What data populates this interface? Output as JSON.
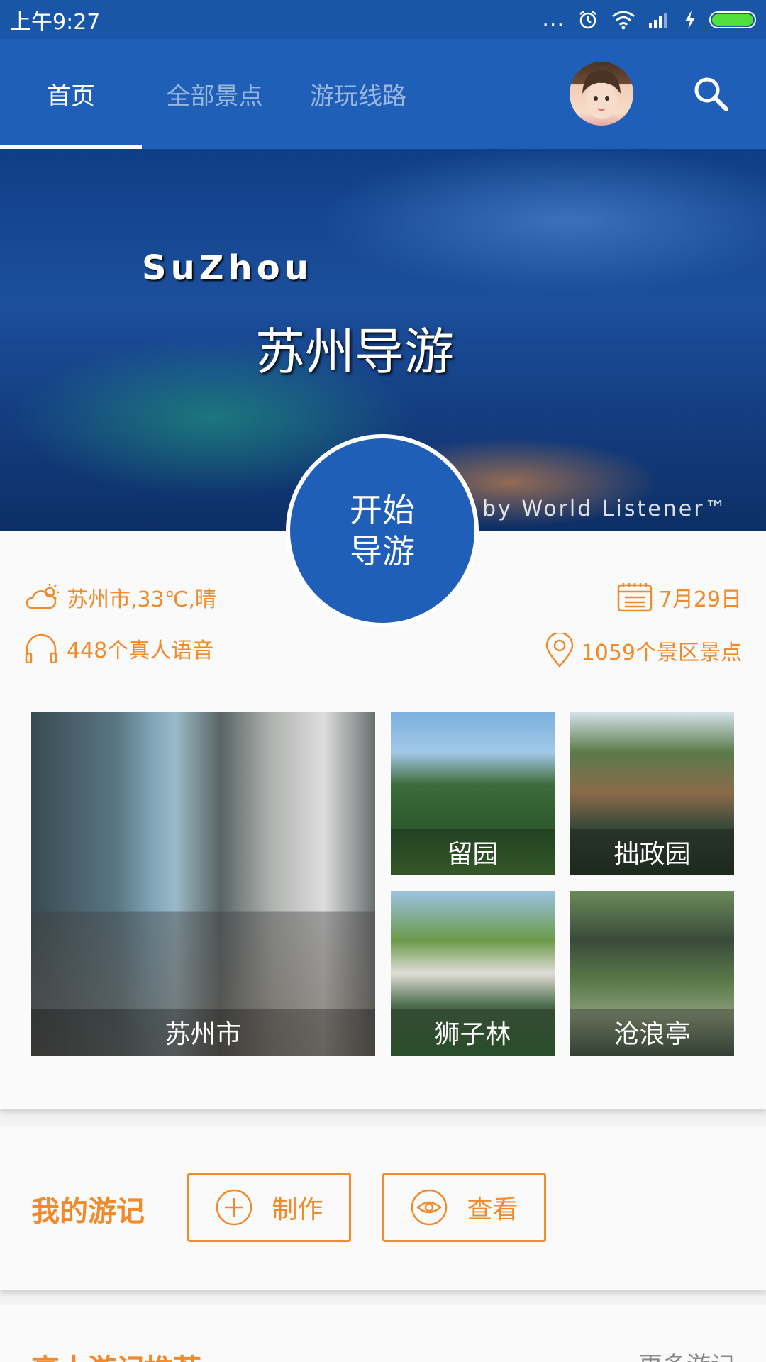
{
  "status_bar": {
    "time": "上午9:27",
    "dots": "...",
    "icons": [
      "alarm-icon",
      "wifi-icon",
      "signal-icon",
      "charging-icon",
      "battery-icon"
    ],
    "battery_color": "#4fe03a"
  },
  "app_bar": {
    "tabs": [
      {
        "label": "首页"
      },
      {
        "label": "全部景点"
      },
      {
        "label": "游玩线路"
      }
    ],
    "active_tab": "首页",
    "avatar_icon": "avatar",
    "search_icon": "search-icon",
    "color": "#1f5fb8"
  },
  "hero": {
    "title_en": "SuZhou",
    "title_cn": "苏州导游",
    "credit": "by World Listener™"
  },
  "start_button": {
    "line1": "开始",
    "line2": "导游"
  },
  "info": {
    "weather": "苏州市,33℃,晴",
    "voice_count": "448个真人语音",
    "date": "7月29日",
    "spot_count": "1059个景区景点",
    "accent_color": "#f08a2a"
  },
  "scenic_spots": [
    {
      "name": "苏州市"
    },
    {
      "name": "留园"
    },
    {
      "name": "拙政园"
    },
    {
      "name": "狮子林"
    },
    {
      "name": "沧浪亭"
    }
  ],
  "my_travel": {
    "title": "我的游记",
    "make_label": "制作",
    "view_label": "查看"
  },
  "bottom": {
    "title": "高人游记推荐",
    "more": "更多游记"
  }
}
